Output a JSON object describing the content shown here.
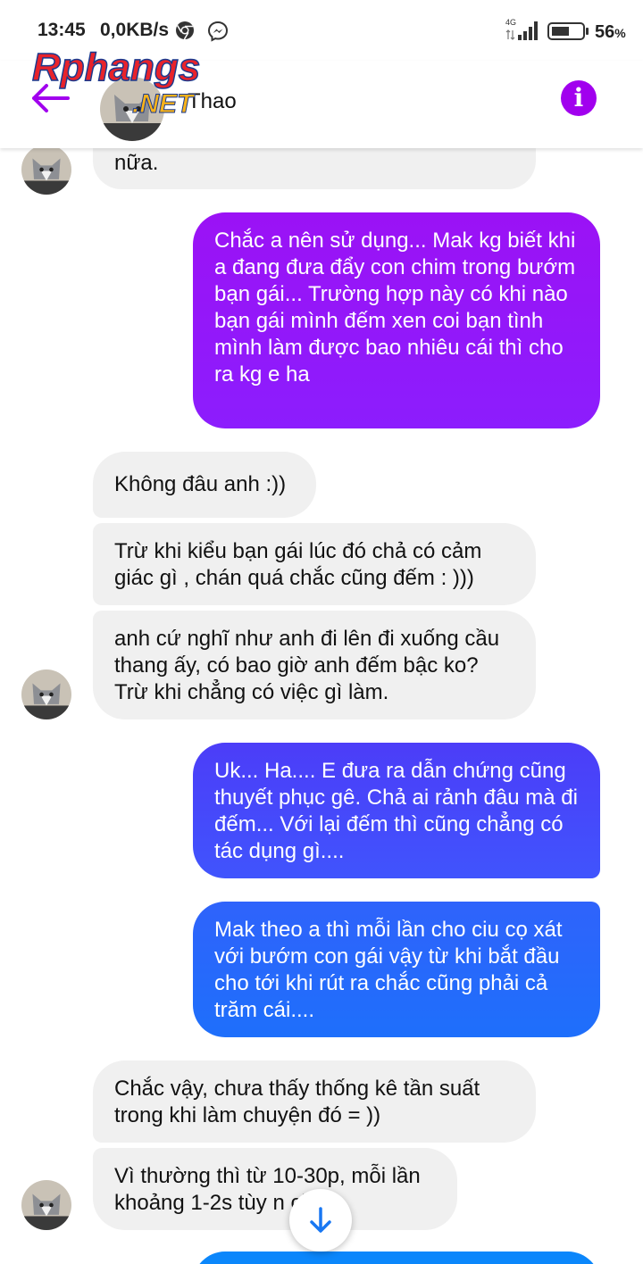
{
  "status_bar": {
    "time": "13:45",
    "network_speed": "0,0KB/s",
    "network_type": "4G",
    "battery_percent": "56",
    "battery_unit": "%",
    "icons": [
      "chrome-icon",
      "messenger-icon",
      "signal-icon",
      "battery-icon"
    ]
  },
  "header": {
    "contact_name": "Thao",
    "watermark_part1": "Rphangs",
    "watermark_part2": ".NET",
    "info_glyph": "i",
    "accent_color": "#a100ee"
  },
  "messages": [
    {
      "side": "in",
      "text": "nữa."
    },
    {
      "side": "out",
      "text": "Chắc  a nên sử dụng... Mak kg biết khi a đang đưa  đẩy  con chim trong bướm bạn gái... Trường hợp này  có  khi nào  bạn  gái  mình đếm xen coi bạn  tình  mình  làm được  bao nhiêu cái  thì  cho ra kg e ha"
    },
    {
      "side": "in",
      "text": "Không đâu anh :))"
    },
    {
      "side": "in",
      "text": "Trừ khi kiểu bạn gái lúc đó chả có cảm giác gì , chán quá chắc cũng đếm : )))"
    },
    {
      "side": "in",
      "text": "anh cứ nghĩ như anh đi lên đi xuống cầu thang ấy, có bao giờ anh đếm bậc ko? Trừ khi chẳng có việc gì làm."
    },
    {
      "side": "out",
      "text": "Uk... Ha.... E đưa  ra dẫn chứng cũng thuyết phục gê.    Chả ai rảnh đâu mà  đi đếm... Với  lại  đếm  thì cũng  chẳng  có  tác dụng  gì...."
    },
    {
      "side": "out",
      "text": "Mak theo a thì  mỗi  lần  cho ciu cọ xát  với  bướm con gái  vậy  từ  khi bắt đầu  cho tới  khi rút  ra chắc cũng  phải  cả trăm  cái...."
    },
    {
      "side": "in",
      "text": "Chắc vậy, chưa thấy thống kê tần suất trong khi làm chuyện đó = ))"
    },
    {
      "side": "in",
      "text": "Vì thường thì từ 10-30p, mỗi lần khoảng 1-2s tùy n     chậm"
    }
  ],
  "colors": {
    "incoming_bubble": "#f0f0f0",
    "outgoing_gradient": [
      "#8c1dfd",
      "#4054fd",
      "#1e6ffb",
      "#0a8cfb"
    ]
  }
}
